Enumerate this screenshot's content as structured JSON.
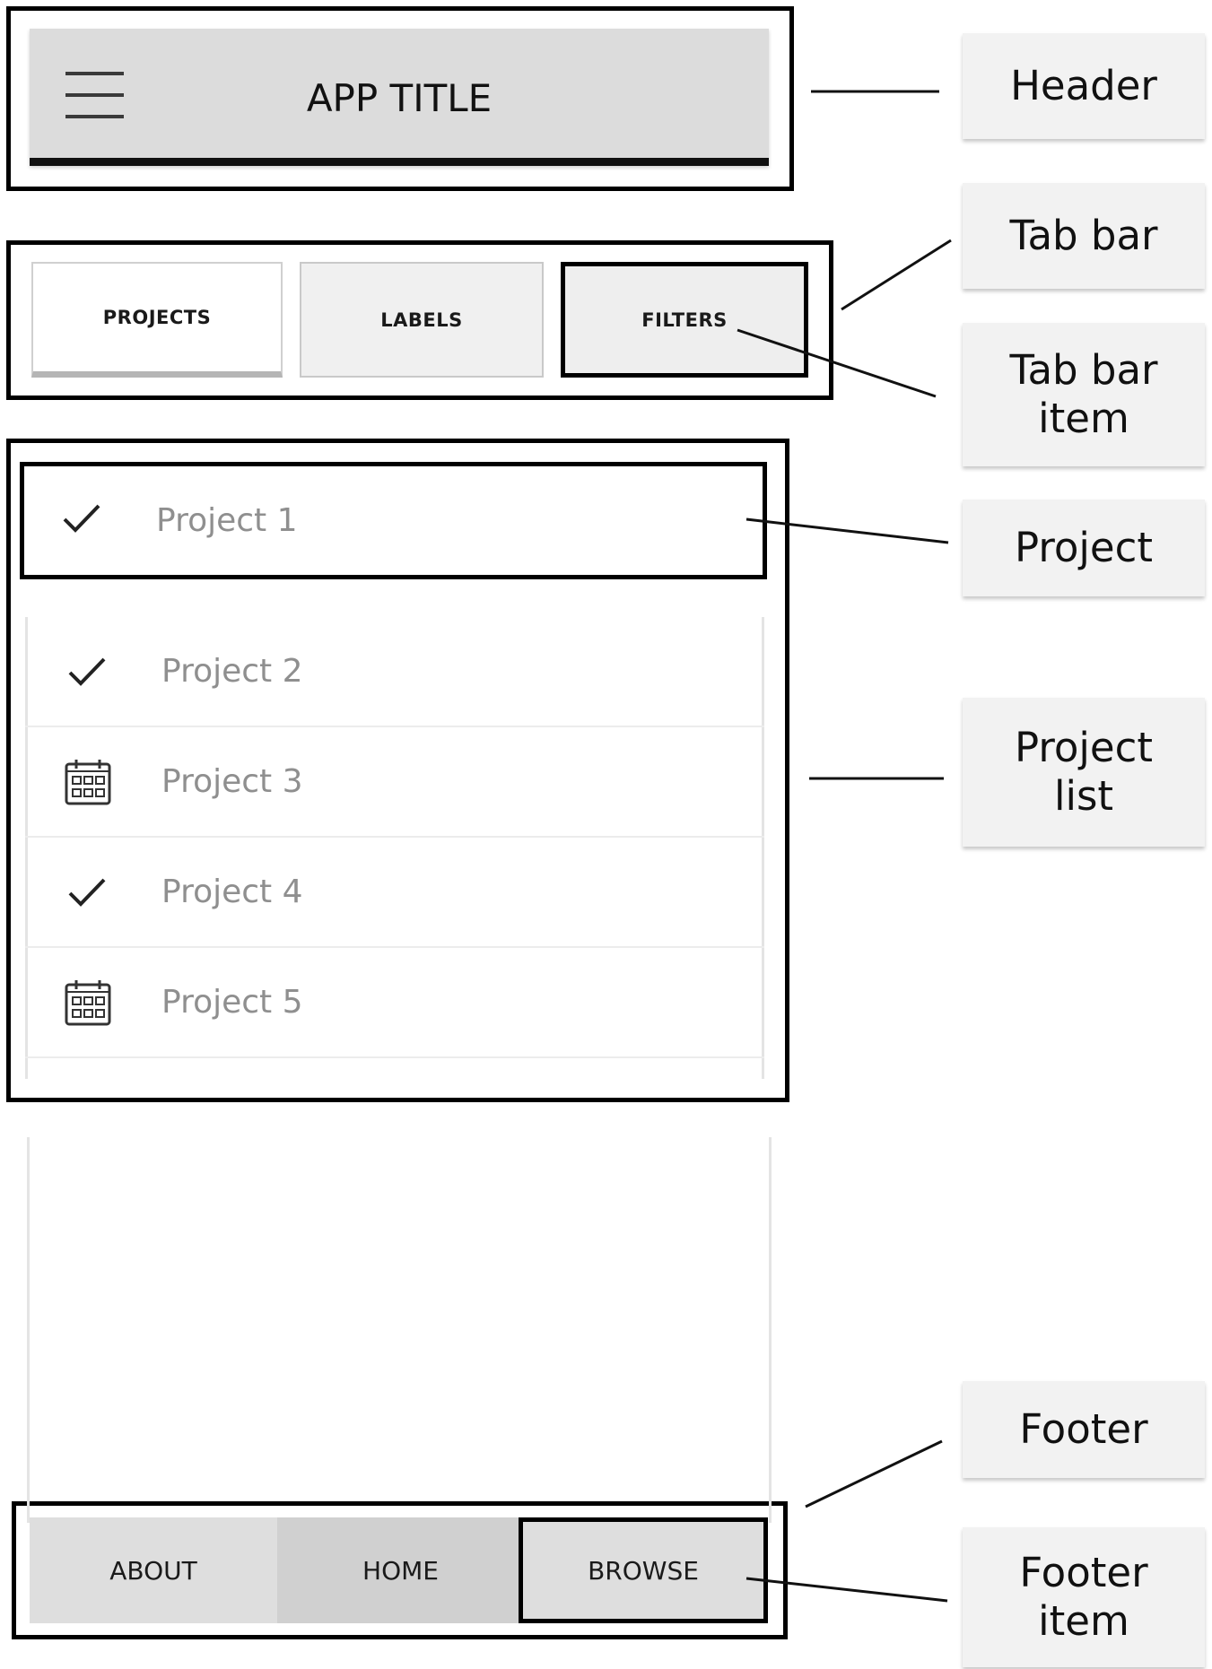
{
  "header": {
    "title": "APP TITLE",
    "menu_icon": "hamburger-menu-icon"
  },
  "tabs": [
    {
      "label": "PROJECTS",
      "state": "active"
    },
    {
      "label": "LABELS"
    },
    {
      "label": "FILTERS"
    }
  ],
  "projects": [
    {
      "name": "Project 1",
      "icon": "checkmark-icon"
    },
    {
      "name": "Project 2",
      "icon": "checkmark-icon"
    },
    {
      "name": "Project 3",
      "icon": "calendar-icon"
    },
    {
      "name": "Project 4",
      "icon": "checkmark-icon"
    },
    {
      "name": "Project 5",
      "icon": "calendar-icon"
    }
  ],
  "footer": [
    {
      "label": "ABOUT"
    },
    {
      "label": "HOME"
    },
    {
      "label": "BROWSE"
    }
  ],
  "annotations": {
    "header": "Header",
    "tab_bar": "Tab bar",
    "tab_bar_item": "Tab bar item",
    "project": "Project",
    "project_list": "Project list",
    "footer": "Footer",
    "footer_item": "Footer item"
  }
}
